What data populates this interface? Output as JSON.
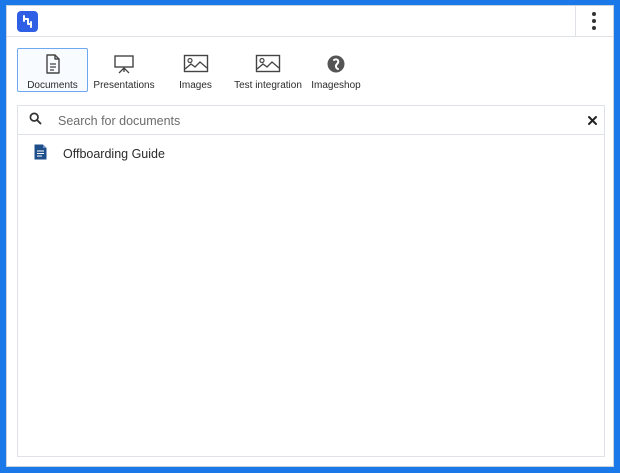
{
  "app": {
    "logo_icon": "app-logo-icon",
    "brand_color": "#2f5fe4",
    "menu_icon": "kebab-menu-icon"
  },
  "tabs": [
    {
      "label": "Documents",
      "icon": "document-icon",
      "active": true
    },
    {
      "label": "Presentations",
      "icon": "presentation-easel-icon",
      "active": false
    },
    {
      "label": "Images",
      "icon": "image-icon",
      "active": false
    },
    {
      "label": "Test integration",
      "icon": "image-icon",
      "active": false
    },
    {
      "label": "Imageshop",
      "icon": "imageshop-icon",
      "active": false
    }
  ],
  "search": {
    "placeholder": "Search for documents",
    "value": "",
    "search_icon": "search-icon",
    "clear_icon": "close-icon"
  },
  "documents": [
    {
      "name": "Offboarding Guide",
      "icon": "document-file-icon",
      "icon_color": "#1f4f8a"
    }
  ]
}
